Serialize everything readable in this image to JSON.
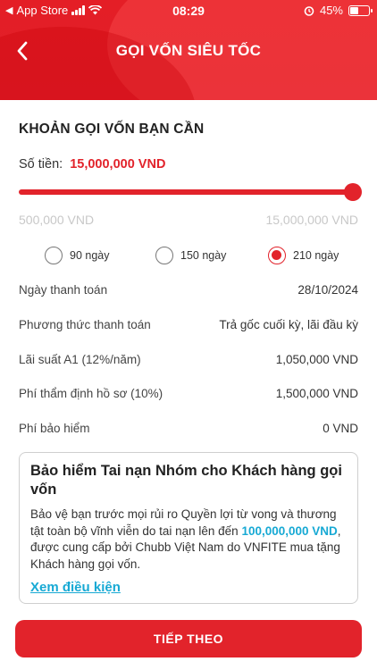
{
  "status_bar": {
    "carrier": "App Store",
    "time": "08:29",
    "battery": "45%"
  },
  "header": {
    "title": "GỌI VỐN SIÊU TỐC"
  },
  "loan": {
    "section_title": "KHOẢN GỌI VỐN BẠN CẦN",
    "amount_label": "Số tiền:",
    "amount_value": "15,000,000 VND",
    "slider_fraction": 1.0,
    "min_label": "500,000 VND",
    "max_label": "15,000,000 VND",
    "terms": [
      {
        "label": "90 ngày",
        "selected": false
      },
      {
        "label": "150 ngày",
        "selected": false
      },
      {
        "label": "210 ngày",
        "selected": true
      }
    ]
  },
  "details": [
    {
      "key": "Ngày thanh toán",
      "value": "28/10/2024"
    },
    {
      "key": "Phương thức thanh toán",
      "value": "Trả gốc cuối kỳ, lãi đầu kỳ"
    },
    {
      "key": "Lãi suất A1 (12%/năm)",
      "value": "1,050,000 VND"
    },
    {
      "key": "Phí thẩm định hồ sơ (10%)",
      "value": "1,500,000 VND"
    },
    {
      "key": "Phí bảo hiểm",
      "value": "0 VND"
    }
  ],
  "insurance": {
    "title": "Bảo hiểm Tai nạn Nhóm cho Khách hàng gọi vốn",
    "desc_part1": "Bảo vệ bạn trước mọi rủi ro Quyền lợi từ vong và thương tật toàn bộ vĩnh viễn do tai nạn lên đến ",
    "desc_highlight": "100,000,000 VND",
    "desc_part2": ", được cung cấp bởi Chubb Việt Nam do VNFITE mua tặng Khách hàng gọi vốn.",
    "link": "Xem điều kiện"
  },
  "next_button": "TIẾP THEO",
  "colors": {
    "primary_red": "#e2232b",
    "link_blue": "#17a9d4"
  }
}
